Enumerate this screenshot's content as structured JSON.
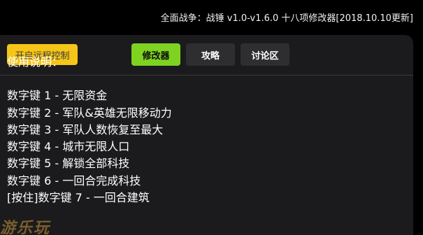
{
  "header": {
    "title": "全面战争：战锤 v1.0-v1.6.0 十八项修改器[2018.10.10更新]"
  },
  "toolbar": {
    "remote_label": "开启远程控制",
    "tabs": [
      {
        "label": "修改器",
        "active": true
      },
      {
        "label": "攻略",
        "active": false
      },
      {
        "label": "讨论区",
        "active": false
      }
    ]
  },
  "content": {
    "heading": "使用说明：",
    "lines": [
      "数字键 1 - 无限资金",
      "数字键 2 - 军队&英雄无限移动力",
      "数字键 3 - 军队人数恢复至最大",
      "数字键 4 - 城市无限人口",
      "数字键 5 - 解锁全部科技",
      "数字键 6 - 一回合完成科技",
      "[按住]数字键 7 - 一回合建筑"
    ]
  },
  "watermark": {
    "text": "游乐玩"
  },
  "colors": {
    "background": "#000000",
    "panel": "#1b1b1d",
    "accent_green": "#7ed321",
    "accent_yellow": "#f5c518",
    "tab_inactive": "#2e2e31"
  }
}
